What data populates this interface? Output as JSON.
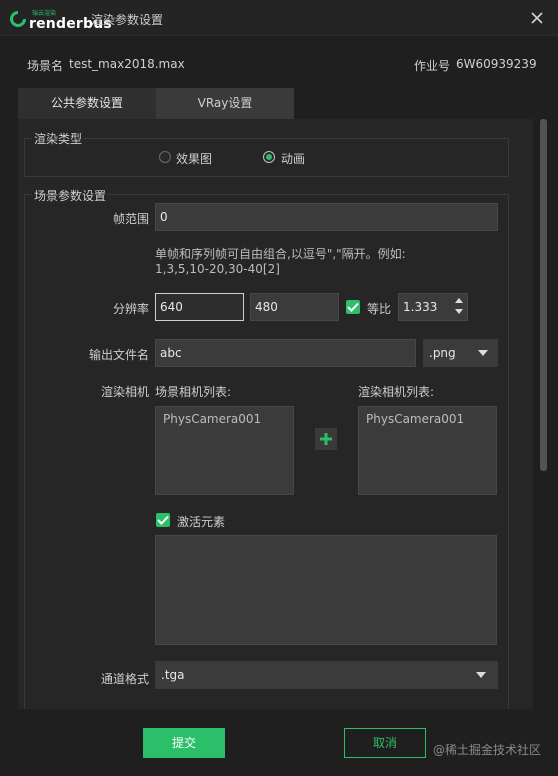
{
  "app": {
    "brand_small": "瑞云渲染",
    "brand": "renderbus",
    "window_title": "渲染参数设置"
  },
  "info": {
    "scene_label": "场景名",
    "scene_value": "test_max2018.max",
    "job_label": "作业号",
    "job_value": "6W60939239"
  },
  "tabs": [
    {
      "label": "公共参数设置",
      "active": true
    },
    {
      "label": "VRay设置",
      "active": false
    }
  ],
  "render_type": {
    "title": "渲染类型",
    "options": [
      {
        "label": "效果图",
        "selected": false
      },
      {
        "label": "动画",
        "selected": true
      }
    ]
  },
  "scene_settings": {
    "title": "场景参数设置",
    "frame_range_label": "帧范围",
    "frame_range_value": "0",
    "frame_hint_line1": "单帧和序列帧可自由组合,以逗号\",\"隔开。例如:",
    "frame_hint_line2": "1,3,5,10-20,30-40[2]",
    "resolution_label": "分辨率",
    "width_value": "640",
    "height_value": "480",
    "ratio_label": "等比",
    "ratio_checked": true,
    "ratio_value": "1.333",
    "output_label": "输出文件名",
    "output_value": "abc",
    "output_format": ".png",
    "camera_label": "渲染相机",
    "scene_camera_list_label": "场景相机列表:",
    "render_camera_list_label": "渲染相机列表:",
    "scene_cameras": [
      "PhysCamera001"
    ],
    "render_cameras": [
      "PhysCamera001"
    ],
    "activate_label": "激活元素",
    "activate_checked": true,
    "channel_label": "通道格式",
    "channel_value": ".tga"
  },
  "footer": {
    "submit_label": "提交",
    "cancel_label": "取消",
    "watermark": "@稀土掘金技术社区"
  },
  "colors": {
    "accent": "#2bbf6a",
    "background": "#1f1f1f",
    "panel": "#262626",
    "input": "#3b3b3b"
  }
}
